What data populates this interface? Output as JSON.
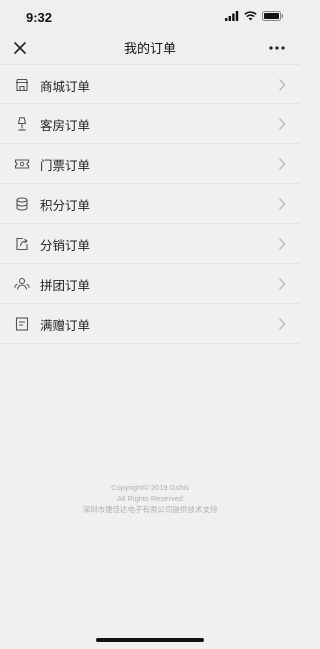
{
  "status_bar": {
    "time": "9:32"
  },
  "nav": {
    "title": "我的订单"
  },
  "orders": [
    {
      "label": "商城订单",
      "icon": "store-icon"
    },
    {
      "label": "客房订单",
      "icon": "lamp-icon"
    },
    {
      "label": "门票订单",
      "icon": "ticket-icon"
    },
    {
      "label": "积分订单",
      "icon": "coins-icon"
    },
    {
      "label": "分销订单",
      "icon": "share-icon"
    },
    {
      "label": "拼团订单",
      "icon": "group-icon"
    },
    {
      "label": "满赠订单",
      "icon": "document-icon"
    }
  ],
  "footer": {
    "line1": "Copyright© 2019 Gshis",
    "line2": "All Rights Reserved",
    "line3": "深圳市捷佳达电子有限公司提供技术支持"
  },
  "colors": {
    "background": "#f0f0f0",
    "text": "#222222",
    "icon": "#555555",
    "chevron": "#b5b5b5"
  }
}
